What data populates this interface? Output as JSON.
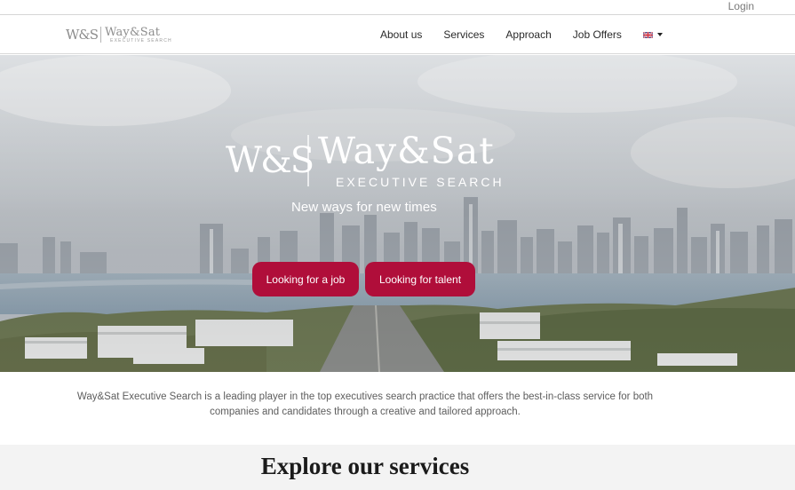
{
  "topbar": {
    "login_label": "Login"
  },
  "header": {
    "logo": {
      "mark": "W&S",
      "brand": "Way&Sat",
      "subtitle": "EXECUTIVE SEARCH"
    },
    "nav": [
      {
        "label": "About us"
      },
      {
        "label": "Services"
      },
      {
        "label": "Approach"
      },
      {
        "label": "Job Offers"
      }
    ],
    "language": {
      "icon": "uk-flag-icon",
      "dropdown_icon": "caret-down-icon"
    }
  },
  "hero": {
    "logo": {
      "mark": "W&S",
      "brand": "Way&Sat",
      "subtitle": "EXECUTIVE SEARCH"
    },
    "tagline": "New ways for new times",
    "buttons": {
      "job_label": "Looking for a job",
      "talent_label": "Looking for talent"
    }
  },
  "intro": {
    "text": "Way&Sat Executive Search is a leading player in the top executives search practice that offers the best-in-class service for both companies and candidates through a creative and tailored approach."
  },
  "explore": {
    "title": "Explore our services"
  },
  "colors": {
    "accent": "#b00e3a",
    "text": "#333333",
    "muted_bg": "#f3f3f3"
  }
}
